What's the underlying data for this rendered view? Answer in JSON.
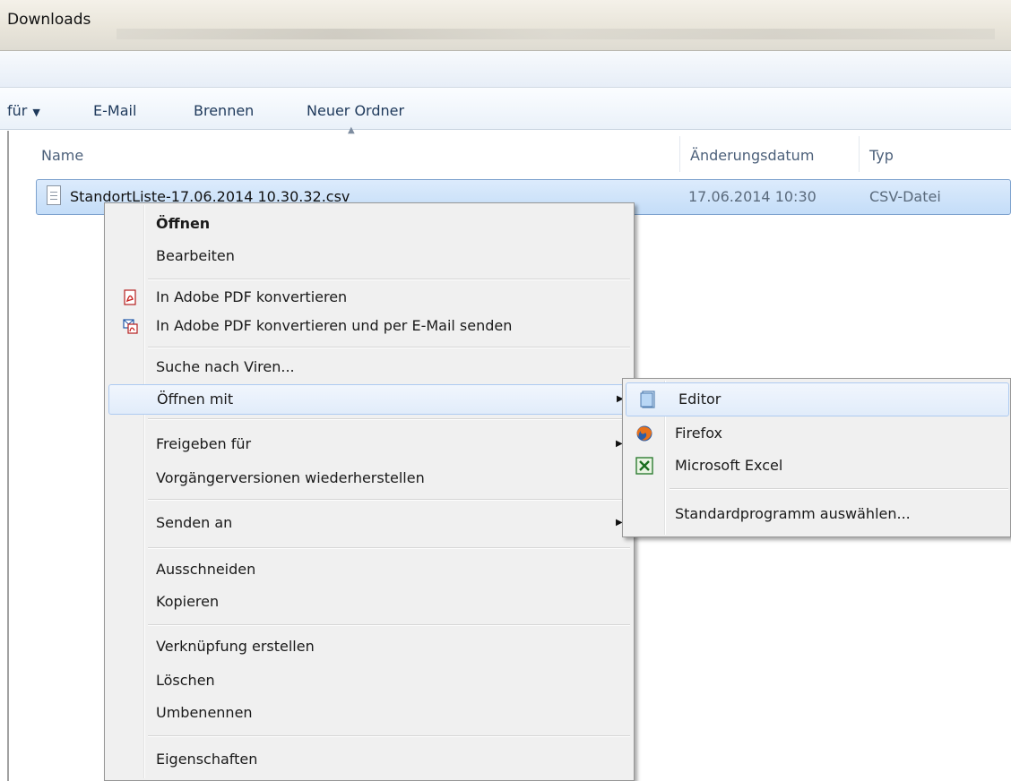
{
  "window": {
    "title": "Downloads"
  },
  "toolbar": {
    "share_label": "für",
    "email_label": "E-Mail",
    "burn_label": "Brennen",
    "new_folder_label": "Neuer Ordner"
  },
  "columns": {
    "name": "Name",
    "date": "Änderungsdatum",
    "type": "Typ"
  },
  "file": {
    "name": "StandortListe-17.06.2014 10.30.32.csv",
    "date": "17.06.2014 10:30",
    "type": "CSV-Datei"
  },
  "context_menu": {
    "open": "Öffnen",
    "edit": "Bearbeiten",
    "to_pdf": "In Adobe PDF konvertieren",
    "to_pdf_email": "In Adobe PDF konvertieren und per E-Mail senden",
    "virus_scan": "Suche nach Viren...",
    "open_with": "Öffnen mit",
    "share_with": "Freigeben für",
    "restore_versions": "Vorgängerversionen wiederherstellen",
    "send_to": "Senden an",
    "cut": "Ausschneiden",
    "copy": "Kopieren",
    "create_shortcut": "Verknüpfung erstellen",
    "delete": "Löschen",
    "rename": "Umbenennen",
    "properties": "Eigenschaften"
  },
  "open_with_menu": {
    "editor": "Editor",
    "firefox": "Firefox",
    "excel": "Microsoft Excel",
    "choose_default": "Standardprogramm auswählen..."
  }
}
